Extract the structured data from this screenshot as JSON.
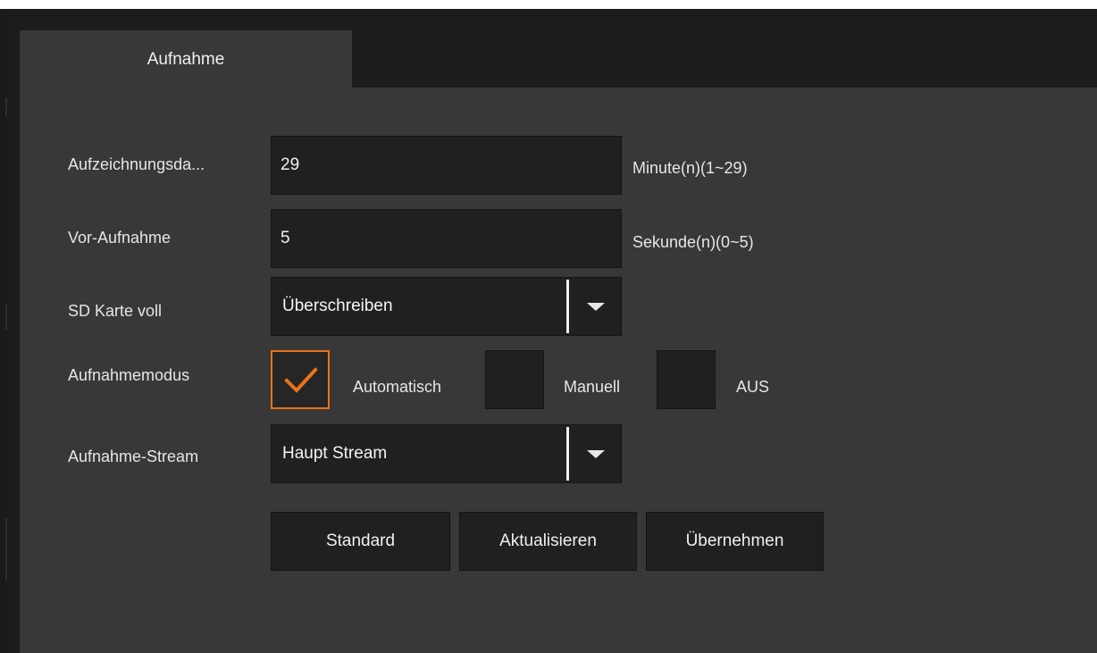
{
  "tab": {
    "label": "Aufnahme"
  },
  "fields": {
    "record_duration": {
      "label": "Aufzeichnungsda...",
      "value": "29",
      "unit": "Minute(n)(1~29)"
    },
    "pre_record": {
      "label": "Vor-Aufnahme",
      "value": "5",
      "unit": "Sekunde(n)(0~5)"
    },
    "sd_full": {
      "label": "SD Karte voll",
      "selected": "Überschreiben"
    },
    "record_mode": {
      "label": "Aufnahmemodus",
      "options": [
        {
          "label": "Automatisch",
          "checked": true
        },
        {
          "label": "Manuell",
          "checked": false
        },
        {
          "label": "AUS",
          "checked": false
        }
      ]
    },
    "record_stream": {
      "label": "Aufnahme-Stream",
      "selected": "Haupt Stream"
    }
  },
  "buttons": {
    "default_label": "Standard",
    "refresh_label": "Aktualisieren",
    "apply_label": "Übernehmen"
  },
  "colors": {
    "accent": "#e8731a",
    "panel": "#383838",
    "input": "#202020",
    "page_background": "#1c1c1c"
  },
  "icons": {
    "dropdown": "chevron-down-icon",
    "checkmark": "check-icon"
  }
}
